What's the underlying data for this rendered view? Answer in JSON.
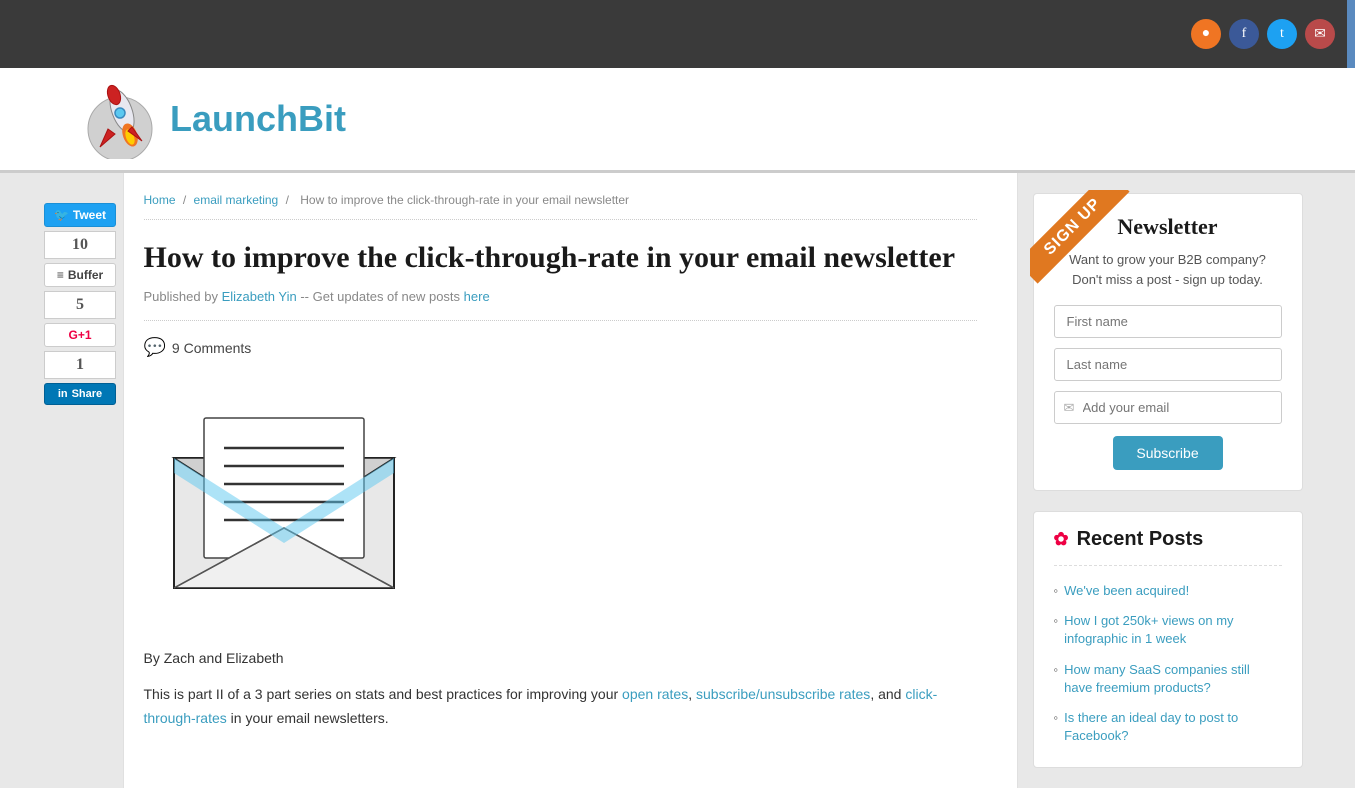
{
  "site": {
    "title": "LaunchBit"
  },
  "topbar": {
    "social": {
      "rss_label": "RSS",
      "fb_label": "f",
      "tw_label": "t",
      "email_label": "✉"
    }
  },
  "breadcrumb": {
    "home": "Home",
    "category": "email marketing",
    "current": "How to improve the click-through-rate in your email newsletter"
  },
  "article": {
    "title": "How to improve the click-through-rate in your email newsletter",
    "author_prefix": "Published by ",
    "author": "Elizabeth Yin",
    "author_suffix": " -- Get updates of new posts ",
    "here_text": "here",
    "comments_count": "9 Comments",
    "body_line1": "By Zach and Elizabeth",
    "body_line2": "This is part II of a 3 part series on stats and best practices for improving your ",
    "open_rates": "open rates",
    "body_and": ", ",
    "subscribe_link": "subscribe/unsubscribe rates",
    "body_and2": ", and ",
    "ctr_link": "click-through-rates",
    "body_end": " in your email newsletters."
  },
  "social_bar": {
    "tweet_label": "Tweet",
    "count_10": "10",
    "buffer_label": "Buffer",
    "count_5": "5",
    "gplus_label": "G+1",
    "count_1": "1",
    "share_label": "Share"
  },
  "newsletter": {
    "ribbon_text": "SIGN UP",
    "title": "Newsletter",
    "description": "Want to grow your B2B company?\nDon't miss a post - sign up today.",
    "first_name_placeholder": "First name",
    "last_name_placeholder": "Last name",
    "email_placeholder": "Add your email",
    "subscribe_label": "Subscribe"
  },
  "recent_posts": {
    "title": "Recent Posts",
    "items": [
      {
        "text": "We've been acquired!"
      },
      {
        "text": "How I got 250k+ views on my infographic in 1 week"
      },
      {
        "text": "How many SaaS companies still have freemium products?"
      },
      {
        "text": "Is there an ideal day to post to Facebook?"
      }
    ]
  }
}
